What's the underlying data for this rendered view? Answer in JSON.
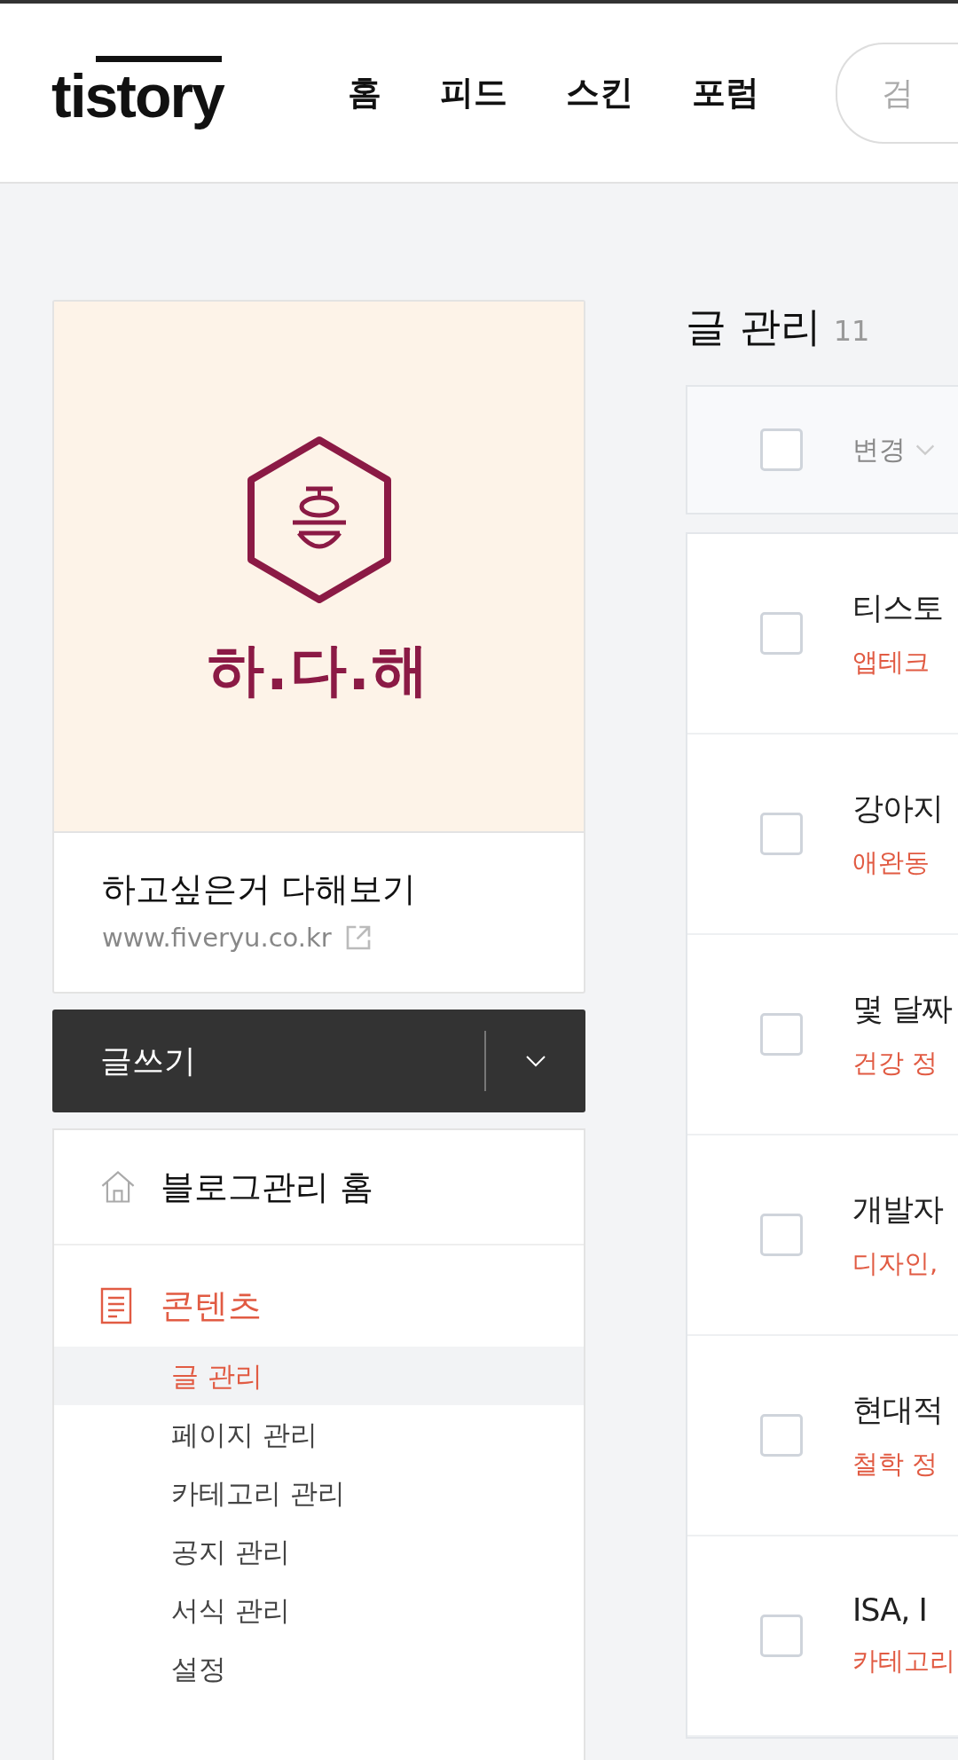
{
  "header": {
    "logo": "tistory",
    "nav": [
      {
        "label": "홈"
      },
      {
        "label": "피드"
      },
      {
        "label": "스킨"
      },
      {
        "label": "포럼"
      }
    ],
    "search": {
      "placeholder": "검"
    }
  },
  "blog": {
    "emblem_text": "하.다.해",
    "name": "하고싶은거 다해보기",
    "url": "www.fiveryu.co.kr"
  },
  "write_button": "글쓰기",
  "menu": {
    "home": "블로그관리 홈",
    "section": {
      "label": "콘텐츠",
      "active": true,
      "items": [
        {
          "label": "글 관리",
          "selected": true
        },
        {
          "label": "페이지 관리",
          "selected": false
        },
        {
          "label": "카테고리 관리",
          "selected": false
        },
        {
          "label": "공지 관리",
          "selected": false
        },
        {
          "label": "서식 관리",
          "selected": false
        },
        {
          "label": "설정",
          "selected": false
        }
      ]
    }
  },
  "posts": {
    "title": "글 관리",
    "count": "11",
    "header": {
      "checked": false,
      "action": "변경"
    },
    "rows": [
      {
        "title": "티스토",
        "category": "앱테크",
        "checked": false
      },
      {
        "title": "강아지",
        "category": "애완동",
        "checked": false
      },
      {
        "title": "몇 달짜",
        "category": "건강 정",
        "checked": false
      },
      {
        "title": "개발자",
        "category": "디자인,",
        "checked": false
      },
      {
        "title": "현대적",
        "category": "철학 정",
        "checked": false
      },
      {
        "title": "ISA, I",
        "category": "카테고리",
        "checked": false
      }
    ]
  }
}
